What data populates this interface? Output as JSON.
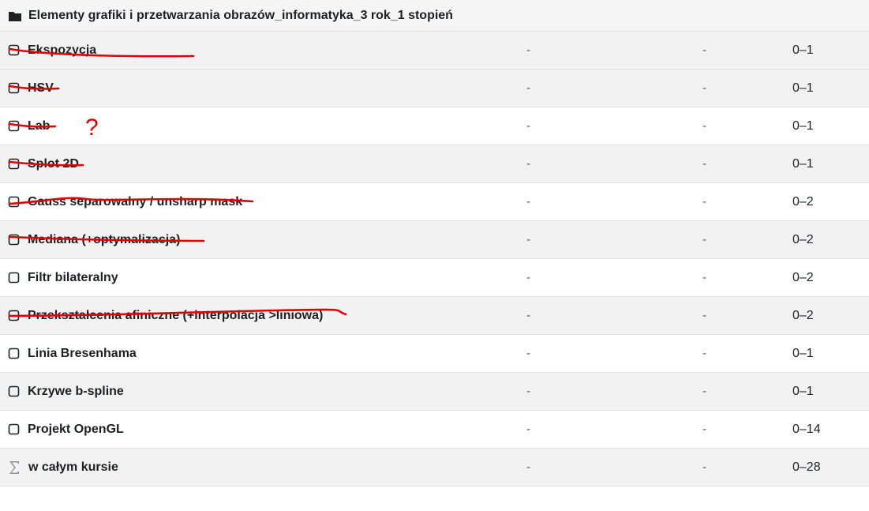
{
  "category": {
    "icon": "folder-icon",
    "title": "Elementy grafiki i przetwarzania obrazów_informatyka_3 rok_1 stopień"
  },
  "items": [
    {
      "name": "Ekspozycja",
      "col_a": "-",
      "col_b": "-",
      "range": "0–1",
      "icon": "checkbox-icon",
      "crossed_out": true
    },
    {
      "name": "HSV",
      "col_a": "-",
      "col_b": "-",
      "range": "0–1",
      "icon": "checkbox-icon",
      "crossed_out": true
    },
    {
      "name": "Lab",
      "col_a": "-",
      "col_b": "-",
      "range": "0–1",
      "icon": "checkbox-icon",
      "crossed_out": true,
      "annotation": "?"
    },
    {
      "name": "Splot 2D",
      "col_a": "-",
      "col_b": "-",
      "range": "0–1",
      "icon": "checkbox-icon",
      "crossed_out": true
    },
    {
      "name": "Gauss separowalny / unsharp mask",
      "col_a": "-",
      "col_b": "-",
      "range": "0–2",
      "icon": "checkbox-icon",
      "crossed_out": true
    },
    {
      "name": "Mediana (+optymalizacja)",
      "col_a": "-",
      "col_b": "-",
      "range": "0–2",
      "icon": "checkbox-icon",
      "crossed_out": true
    },
    {
      "name": "Filtr bilateralny",
      "col_a": "-",
      "col_b": "-",
      "range": "0–2",
      "icon": "checkbox-icon",
      "crossed_out": false
    },
    {
      "name": "Przekształcenia afiniczne (+interpolacja >liniowa)",
      "col_a": "-",
      "col_b": "-",
      "range": "0–2",
      "icon": "checkbox-icon",
      "crossed_out": true
    },
    {
      "name": "Linia Bresenhama",
      "col_a": "-",
      "col_b": "-",
      "range": "0–1",
      "icon": "checkbox-icon",
      "crossed_out": false
    },
    {
      "name": "Krzywe b-spline",
      "col_a": "-",
      "col_b": "-",
      "range": "0–1",
      "icon": "checkbox-icon",
      "crossed_out": false
    },
    {
      "name": "Projekt OpenGL",
      "col_a": "-",
      "col_b": "-",
      "range": "0–14",
      "icon": "checkbox-icon",
      "crossed_out": false
    }
  ],
  "total": {
    "name": "w całym kursie",
    "col_a": "-",
    "col_b": "-",
    "range": "0–28",
    "icon": "sigma-icon"
  },
  "colors": {
    "annotation_red": "#e00000",
    "alt_row": "#f2f2f2"
  }
}
